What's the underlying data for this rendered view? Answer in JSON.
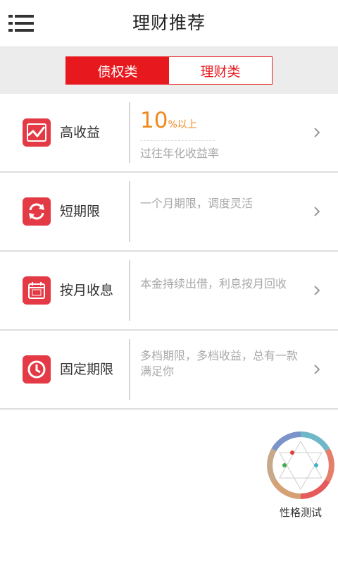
{
  "header": {
    "title": "理财推荐",
    "menu_icon": "hamburger-menu-icon"
  },
  "tabs": [
    {
      "label": "债权类",
      "active": true
    },
    {
      "label": "理财类",
      "active": false
    }
  ],
  "items": [
    {
      "icon": "trend-chart-icon",
      "title": "高收益",
      "rate_value": "10",
      "rate_suffix": "%以上",
      "desc": "过往年化收益率"
    },
    {
      "icon": "refresh-icon",
      "title": "短期限",
      "desc": "一个月期限，调度灵活"
    },
    {
      "icon": "calendar-icon",
      "title": "按月收息",
      "desc": "本金持续出借，利息按月回收"
    },
    {
      "icon": "clock-icon",
      "title": "固定期限",
      "desc": "多档期限，多档收益，总有一款满足你"
    }
  ],
  "personality": {
    "label": "性格测试",
    "icon": "hexagram-wheel-icon"
  },
  "colors": {
    "accent": "#e8191e",
    "icon_bg": "#e33a45",
    "rate": "#f08a1e"
  }
}
